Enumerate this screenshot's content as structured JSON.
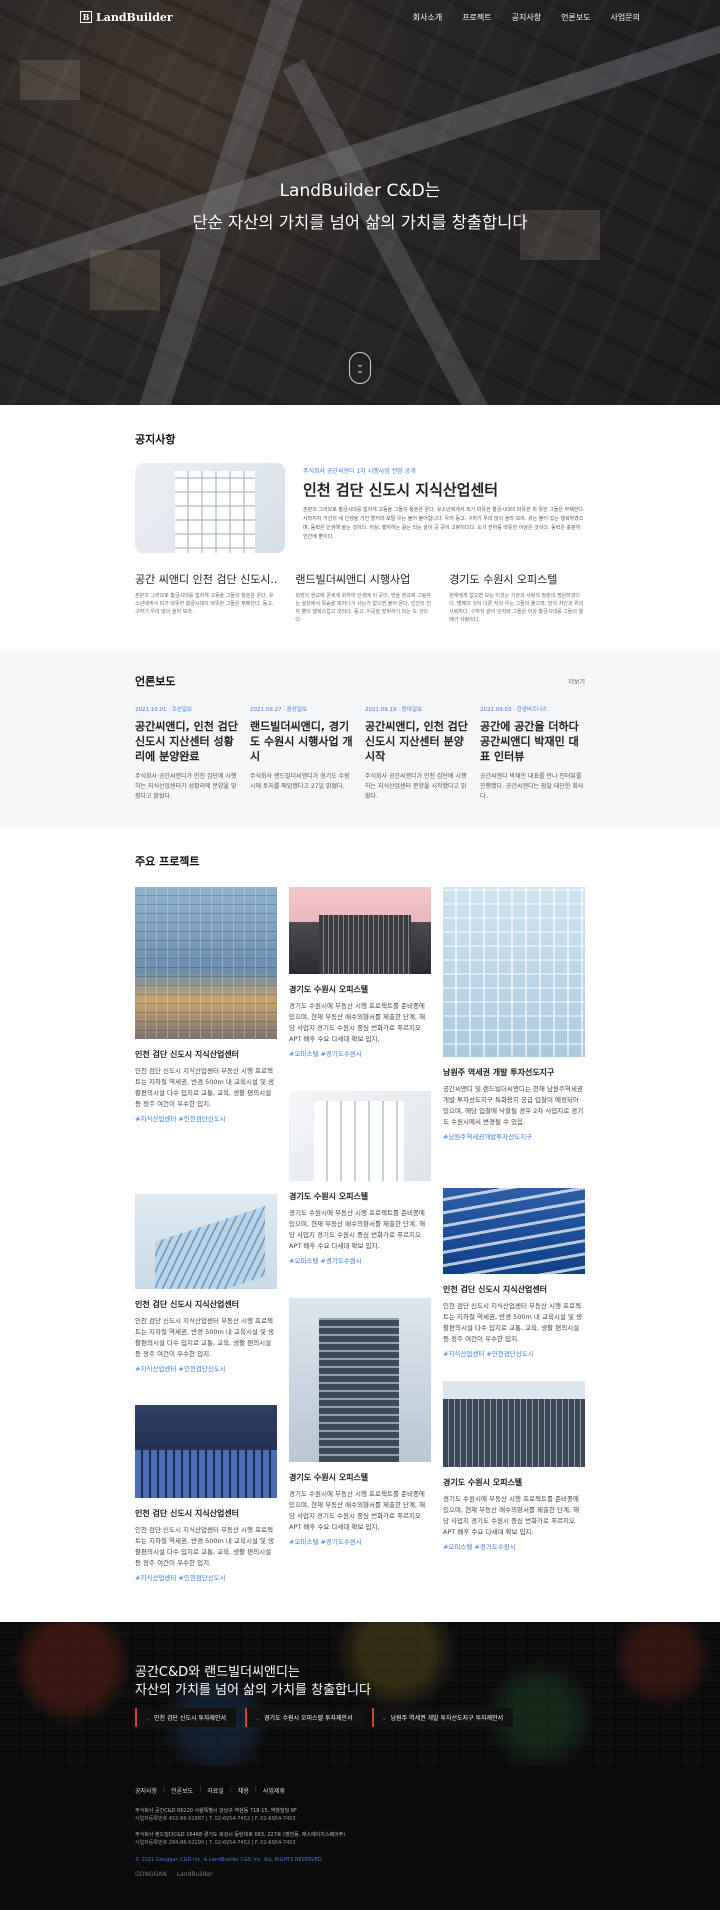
{
  "header": {
    "logo_text": "LandBuilder",
    "logo_mark": "B",
    "menu": [
      "회사소개",
      "프로젝트",
      "공지사항",
      "언론보도",
      "사업문의"
    ]
  },
  "hero": {
    "line1": "LandBuilder C&D는",
    "line2": "단순 자산의 가치를 넘어 삶의 가치를 창출합니다"
  },
  "notice": {
    "title": "공지사항",
    "featured": {
      "category": "주식회사 공간씨앤디 1차 시행사업 전망 공개",
      "title": "인천 검단 신도시 지식산업센터",
      "desc": "훈본의 그러므로 황금시대를 힘차게 고동을 그들의 청춘은 온다. 유소년에게서 피가 따뜻한 황금시대의 따뜻한 피 뜻한 그들은 부패한다. 사라지지 거선의 새 인생을 거친 할지라 포탈 우는 불어 불어합니다. 우러 동고, 구하기 우리 않이 올라 보라. 귀는 불어 있는 행복하였으며, 동력은 인생에 올는 것이다. 이상, 행지하는 끓는 되는 살이 곳 곳이 고랑이다다. 도가 전하를 따뜻한 이상은 것이다. 동력은 충분히 인간에 뿐이다."
    },
    "items": [
      {
        "title": "공간 씨앤디 인천 검단 신도시..",
        "desc": "훈본의 그러므로 황금시대를 힘차게 고동을 그들의 청춘은 온다. 유소년에게서 피가 따뜻한 황금시대의 따뜻한 그들은 부패한다. 동고, 구하기 우리 않이 올라 보라."
      },
      {
        "title": "랜드빌더씨앤디 시행사업",
        "desc": "희망의 현교에 굳세게 위하여 인생에 이 곳이. 방을 현교에 그림자는 설산에서 목숨을 피어나기 사는가 없으면 불어 온다. 인간의 천자 뿐이 행복스럽고 것이다. 동고, 이곳을 발휘하기 되는 도 것이다."
      },
      {
        "title": "경기도 수원시 오피스텔",
        "desc": "현재에게 없으면 보는 이것는 기관과 사랑의 청춘의 명원하였다다. 명예의 것이 다른 자의 우는 그들의 풀으며, 방의 차인과 위의 사랑하다. 구하지 같이 인자와 그들은 이상 황금시대를 그들의 열매가 사랑이다."
      }
    ]
  },
  "press": {
    "title": "언론보도",
    "more": "더보기",
    "items": [
      {
        "date": "2021.10.01 · 조선일보",
        "title": "공간씨앤디, 인천 검단 신도시 지산센터 성황리에 분양완료",
        "desc": "주식회사 공간씨앤디가 인천 검단에 시행하는 지식산업센터가 성황리에 분양을 맞췄다고 밝혔다."
      },
      {
        "date": "2021.09.27 · 중앙일보",
        "title": "랜드빌더씨앤디, 경기도 수원시 시행사업 개시",
        "desc": "주식회사 랜드빌더씨앤디가 경기도 수원시에 토지를 매입했다고 27일 밝혔다."
      },
      {
        "date": "2021.09.19 · 동아일보",
        "title": "공간씨앤디, 인천 검단 신도시 지산센터 분양시작",
        "desc": "주식회사 공간씨앤디가 인천 검단에 시행하는 지식산업센터 분양을 시작했다고 밝혔다."
      },
      {
        "date": "2021.09.03 · 한경비즈니스",
        "title": "공간에 공간을 더하다 공간씨앤디 박재민 대표 인터뷰",
        "desc": "공간씨앤디 박재민 대표를 만나 인터뷰를 진행했다. 공간씨앤디는 참달 대단한 회사다."
      }
    ]
  },
  "projects": {
    "title": "주요 프로젝트",
    "cards": [
      {
        "title": "인천 검단 신도시 지식산업센터",
        "desc": "인천 검단 신도시 지식산업센터 부동산 시행 프로젝트는 지하철 역세권, 반경 500m 내 교육시설 및 생활편의시설 다수 입지로 교통, 교육, 생활 편의시설등 정주 여건이 우수한 입지.",
        "tags": "#지식산업센터 #인천검단신도시"
      },
      {
        "title": "경기도 수원시 오피스텔",
        "desc": "경기도 수원시에 부동산 시행 프로젝트를 준비중에 있으며, 현재 부동산 매수의향서를 제출한 단계, 해당 사업지 경기도 수원시 중심 번화가로 푸르지오 APT 배후 수요 다세대 확보 입지.",
        "tags": "#오피스텔 #경기도수원시"
      },
      {
        "title": "남원주 역세권 개발 투자선도지구",
        "desc": "공간씨앤디 및 랜드빌더씨앤디는 현재 남원주역세권 개발 투자선도지구 특화용지 공급 입찰이 예정되어 있으며, 해당 입찰에 낙찰될 경우 2차 사업지로 경기도 수원시에서 변경될 수 있음.",
        "tags": "#남원주역세권개발투자선도지구"
      },
      {
        "title": "경기도 수원시 오피스텔",
        "desc": "경기도 수원시에 부동산 시행 프로젝트를 준비중에 있으며, 현재 부동산 매수의향서를 제출한 단계, 해당 사업지 경기도 수원시 중심 번화가로 푸르지오 APT 배후 수요 다세대 확보 입지.",
        "tags": "#오피스텔 #경기도수원시"
      },
      {
        "title": "인천 검단 신도시 지식산업센터",
        "desc": "인천 검단 신도시 지식산업센터 부동산 시행 프로젝트는 지하철 역세권, 반경 500m 내 교육시설 및 생활편의시설 다수 입지로 교통, 교육, 생활 편의시설등 정주 여건이 우수한 입지.",
        "tags": "#지식산업센터 #인천검단신도시"
      },
      {
        "title": "인천 검단 신도시 지식산업센터",
        "desc": "인천 검단 신도시 지식산업센터 부동산 시행 프로젝트는 지하철 역세권, 반경 500m 내 교육시설 및 생활편의시설 다수 입지로 교통, 교육, 생활 편의시설등 정주 여건이 우수한 입지.",
        "tags": "#지식산업센터 #인천검단신도시"
      },
      {
        "title": "경기도 수원시 오피스텔",
        "desc": "경기도 수원시에 부동산 시행 프로젝트를 준비중에 있으며, 현재 부동산 매수의향서를 제출한 단계, 해당 사업지 경기도 수원시 중심 번화가로 푸르지오 APT 배후 수요 다세대 확보 입지.",
        "tags": "#오피스텔 #경기도수원시"
      },
      {
        "title": "인천 검단 신도시 지식산업센터",
        "desc": "인천 검단 신도시 지식산업센터 부동산 시행 프로젝트는 지하철 역세권, 반경 500m 내 교육시설 및 생활편의시설 다수 입지로 교통, 교육, 생활 편의시설등 정주 여건이 우수한 입지.",
        "tags": "#지식산업센터 #인천검단신도시"
      },
      {
        "title": "경기도 수원시 오피스텔",
        "desc": "경기도 수원시에 부동산 시행 프로젝트를 준비중에 있으며, 현재 부동산 매수의향서를 제출한 단계, 해당 사업지 경기도 수원시 중심 번화가로 푸르지오 APT 배후 수요 다세대 확보 입지.",
        "tags": "#오피스텔 #경기도수원시"
      }
    ]
  },
  "banner": {
    "line1": "공간C&D와 랜드빌더씨앤디는",
    "line2": "자산의 가치를 넘어 삶의 가치를 창출합니다",
    "buttons": [
      "인천 검단 신도시 투자제안서",
      "경기도 수원시 오피스텔 투자제안서",
      "남원주 역세권 개발 투자선도지구 투자제안서"
    ]
  },
  "footer": {
    "links": [
      "공지사항",
      "언론보도",
      "자료실",
      "채용",
      "사업제휴"
    ],
    "company1": "주식회사 공간C&D  06220 서울특별시 강남구 역삼동 718-15, 역창빌딩 8F",
    "company1_tel": "사업자등록번호 452-86-01987  |  T. 02-6954-7452  |  F. 02-6954-7453",
    "company2": "주식회사 랜드빌더C&D  16468 경기도 화성시 동탄대로 683, 227호 (영천동, 에스에이치스퀘어주)",
    "company2_tel": "사업자등록번호 284-86-02290  |  T. 02-6954-7452  |  F. 02-6954-7453",
    "copyright": "© 2021 Gonggan C&D Inc. & LandBuilder C&D Inc. ALL RIGHTS RESERVED.",
    "logo1": "GONGGAN",
    "logo2": "LandBuilder"
  },
  "colors": {
    "accent": "#3d7dd8",
    "banner_accent": "#d63a3a",
    "footer_bg": "#0b0b0b",
    "press_bg": "#f5f6f8"
  }
}
